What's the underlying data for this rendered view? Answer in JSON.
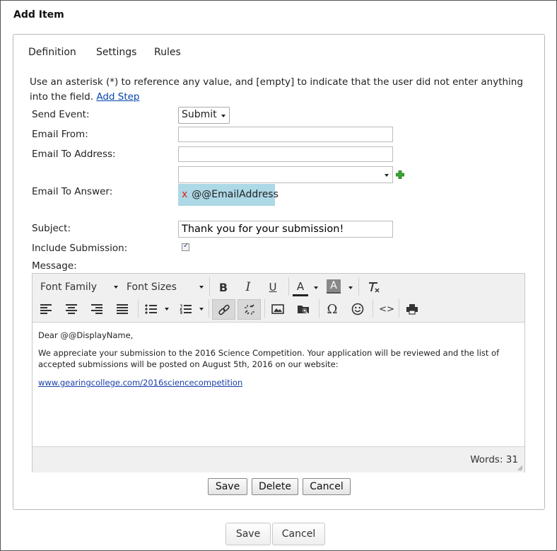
{
  "dialog": {
    "title": "Add Item"
  },
  "tabs": [
    {
      "label": "Definition"
    },
    {
      "label": "Settings"
    },
    {
      "label": "Rules"
    }
  ],
  "intro": {
    "text": "Use an asterisk (*) to reference any value, and [empty] to indicate that the user did not enter anything into the field.",
    "link": "Add Step"
  },
  "form": {
    "send_event": {
      "label": "Send Event:",
      "value": "Submit"
    },
    "email_from": {
      "label": "Email From:",
      "value": ""
    },
    "email_to_address": {
      "label": "Email To Address:",
      "value": ""
    },
    "email_to_answer": {
      "label": "Email To Answer:",
      "select_value": "",
      "chip_remove": "x",
      "chip": "@@EmailAddress"
    },
    "subject": {
      "label": "Subject:",
      "value": "Thank you for your submission!"
    },
    "include_submission": {
      "label": "Include Submission:",
      "checked": true,
      "check_glyph": "✓"
    },
    "message": {
      "label": "Message:"
    }
  },
  "editor": {
    "toolbar": {
      "font_family": "Font Family",
      "font_sizes": "Font Sizes",
      "bold": "B",
      "italic": "I",
      "underline": "U",
      "text_color": "A",
      "bg_color": "A",
      "special_char": "Ω",
      "source_code": "<>"
    },
    "content": {
      "greeting": "Dear @@DisplayName,",
      "paragraph": "We appreciate your submission to the 2016 Science Competition. Your application will be reviewed and the list of accepted submissions will be posted on August 5th, 2016 on our website:",
      "link": "www.gearingcollege.com/2016sciencecompetition"
    },
    "status": {
      "words": "Words: 31"
    }
  },
  "step_buttons": {
    "save": "Save",
    "delete": "Delete",
    "cancel": "Cancel"
  },
  "footer_buttons": {
    "save": "Save",
    "cancel": "Cancel"
  }
}
